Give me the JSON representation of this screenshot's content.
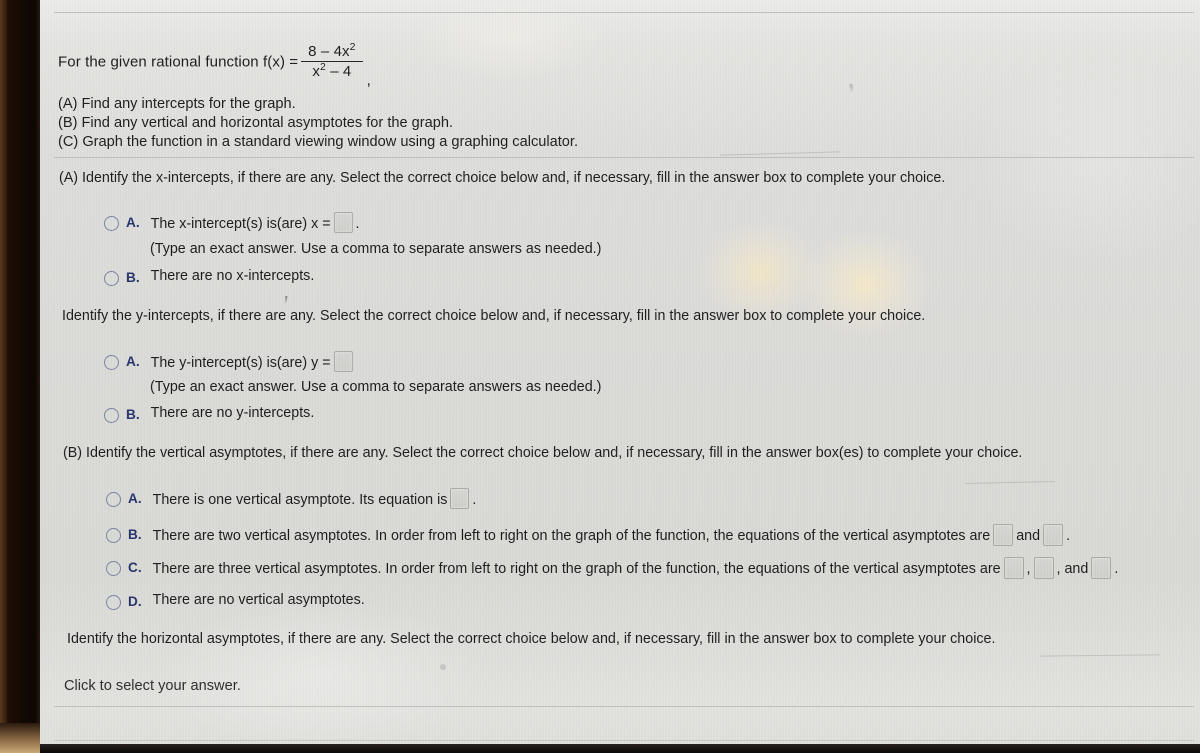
{
  "problem": {
    "lead_text": "For the given rational function f(x) =",
    "fraction": {
      "numerator": "8 – 4x",
      "numerator_exp": "2",
      "denominator": "x",
      "denominator_exp": "2",
      "denominator_tail": " – 4"
    },
    "trailing_punctuation": ",",
    "parts": [
      "(A) Find any intercepts for the graph.",
      "(B) Find any vertical and horizontal asymptotes for the graph.",
      "(C) Graph the function in a standard viewing window using a graphing calculator."
    ]
  },
  "section_x_intercepts": {
    "question": "(A) Identify the x-intercepts, if there are any. Select the correct choice below and, if necessary, fill in the answer box to complete your choice.",
    "option_a": {
      "letter": "A.",
      "text_before_box": "The x-intercept(s) is(are) x =",
      "text_after_box": ".",
      "hint": "(Type an exact answer. Use a comma to separate answers as needed.)",
      "box_value": ""
    },
    "option_b": {
      "letter": "B.",
      "text": "There are no x-intercepts."
    }
  },
  "section_y_intercepts": {
    "question": "Identify the y-intercepts, if there are any. Select the correct choice below and, if necessary, fill in the answer box to complete your choice.",
    "option_a": {
      "letter": "A.",
      "text_before_box": "The y-intercept(s) is(are) y =",
      "text_after_box": "",
      "hint": "(Type an exact answer. Use a comma to separate answers as needed.)",
      "box_value": ""
    },
    "option_b": {
      "letter": "B.",
      "text": "There are no y-intercepts."
    }
  },
  "section_vertical_asymptotes": {
    "question": "(B) Identify the vertical asymptotes, if there are any. Select the correct choice below and, if necessary, fill in the answer box(es) to complete your choice.",
    "option_a": {
      "letter": "A.",
      "text_before_box": "There is one vertical asymptote. Its equation is",
      "text_after_box": ".",
      "box_value": ""
    },
    "option_b": {
      "letter": "B.",
      "text_before_box": "There are two vertical asymptotes. In order from left to right on the graph of the function, the equations of the vertical asymptotes are",
      "joiner": "and",
      "text_after_box": ".",
      "box_value_1": "",
      "box_value_2": ""
    },
    "option_c": {
      "letter": "C.",
      "text_before_box": "There are three vertical asymptotes. In order from left to right on the graph of the function, the equations of the vertical asymptotes are",
      "separator": ",",
      "joiner": ", and",
      "text_after_box": ".",
      "box_value_1": "",
      "box_value_2": "",
      "box_value_3": ""
    },
    "option_d": {
      "letter": "D.",
      "text": "There are no vertical asymptotes."
    }
  },
  "section_horizontal_asymptotes": {
    "question": "Identify the horizontal asymptotes, if there are any. Select the correct choice below and, if necessary, fill in the answer box to complete your choice."
  },
  "footer": {
    "click_note": "Click to select your answer."
  },
  "colors": {
    "screen_background": "#dadad7",
    "text": "#1a1a1a",
    "option_letter": "#23306b",
    "radio_border": "#7b82a0",
    "answer_box_fill": "#d3d3d0",
    "answer_box_border": "#a9a9a6",
    "divider": "#b9b9b6",
    "bezel": "#1d0e06"
  }
}
